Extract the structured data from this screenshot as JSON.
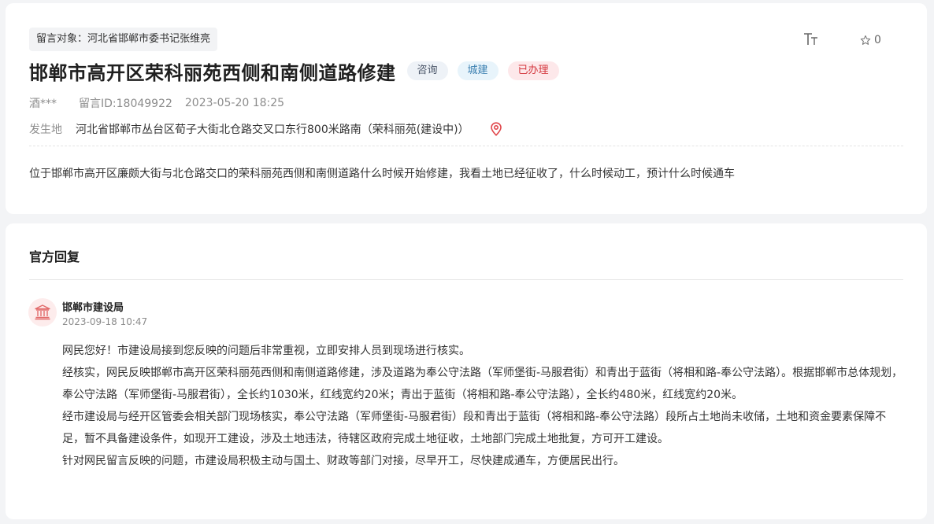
{
  "message": {
    "target_tag": "留言对象：河北省邯郸市委书记张维亮",
    "title": "邯郸市高开区荣科丽苑西侧和南侧道路修建",
    "badges": {
      "consult": "咨询",
      "city": "城建",
      "status": "已办理"
    },
    "author": "酒***",
    "message_id": "留言ID:18049922",
    "datetime": "2023-05-20 18:25",
    "location_label": "发生地",
    "location": "河北省邯郸市丛台区荀子大街北仓路交叉口东行800米路南（荣科丽苑(建设中)）",
    "content": "位于邯郸市高开区廉颇大街与北仓路交口的荣科丽苑西侧和南侧道路什么时候开始修建，我看土地已经征收了，什么时候动工，预计什么时候通车"
  },
  "toolbar": {
    "font_icon": "text-size-icon",
    "fav_icon": "star-outline-icon",
    "fav_count": "0"
  },
  "reply": {
    "heading": "官方回复",
    "department": "邯郸市建设局",
    "datetime": "2023-09-18 10:47",
    "avatar_icon": "government-building-icon",
    "paragraphs": [
      "网民您好！市建设局接到您反映的问题后非常重视，立即安排人员到现场进行核实。",
      "经核实，网民反映邯郸市高开区荣科丽苑西侧和南侧道路修建，涉及道路为奉公守法路（军师堡街-马服君街）和青出于蓝街（将相和路-奉公守法路）。根据邯郸市总体规划，奉公守法路（军师堡街-马服君街），全长约1030米，红线宽约20米；青出于蓝街（将相和路-奉公守法路），全长约480米，红线宽约20米。",
      "经市建设局与经开区管委会相关部门现场核实，奉公守法路（军师堡街-马服君街）段和青出于蓝街（将相和路-奉公守法路）段所占土地尚未收储，土地和资金要素保障不足，暂不具备建设条件，如现开工建设，涉及土地违法，待辖区政府完成土地征收，土地部门完成土地批复，方可开工建设。",
      "针对网民留言反映的问题，市建设局积极主动与国土、财政等部门对接，尽早开工，尽快建成通车，方便居民出行。"
    ]
  },
  "colors": {
    "status_red": "#d4383f",
    "city_blue": "#3a7fb0",
    "location_pin": "#e0474c"
  }
}
